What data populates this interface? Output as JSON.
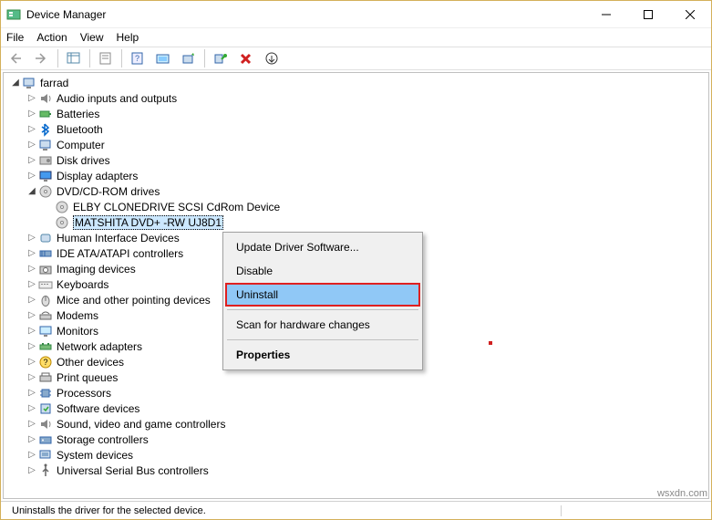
{
  "titlebar": {
    "title": "Device Manager"
  },
  "menubar": {
    "file": "File",
    "action": "Action",
    "view": "View",
    "help": "Help"
  },
  "tree": {
    "root": "farrad",
    "nodes": [
      {
        "label": "Audio inputs and outputs",
        "icon": "speaker"
      },
      {
        "label": "Batteries",
        "icon": "battery"
      },
      {
        "label": "Bluetooth",
        "icon": "bluetooth"
      },
      {
        "label": "Computer",
        "icon": "computer"
      },
      {
        "label": "Disk drives",
        "icon": "disk"
      },
      {
        "label": "Display adapters",
        "icon": "display"
      },
      {
        "label": "DVD/CD-ROM drives",
        "icon": "disc",
        "expanded": true,
        "children": [
          {
            "label": "ELBY CLONEDRIVE SCSI CdRom Device",
            "icon": "disc"
          },
          {
            "label": "MATSHITA DVD+ -RW UJ8D1",
            "icon": "disc",
            "selected": true
          }
        ]
      },
      {
        "label": "Human Interface Devices",
        "icon": "hid"
      },
      {
        "label": "IDE ATA/ATAPI controllers",
        "icon": "ide"
      },
      {
        "label": "Imaging devices",
        "icon": "camera"
      },
      {
        "label": "Keyboards",
        "icon": "keyboard"
      },
      {
        "label": "Mice and other pointing devices",
        "icon": "mouse"
      },
      {
        "label": "Modems",
        "icon": "modem"
      },
      {
        "label": "Monitors",
        "icon": "monitor"
      },
      {
        "label": "Network adapters",
        "icon": "network"
      },
      {
        "label": "Other devices",
        "icon": "unknown"
      },
      {
        "label": "Print queues",
        "icon": "printer"
      },
      {
        "label": "Processors",
        "icon": "cpu"
      },
      {
        "label": "Software devices",
        "icon": "software"
      },
      {
        "label": "Sound, video and game controllers",
        "icon": "sound"
      },
      {
        "label": "Storage controllers",
        "icon": "storage"
      },
      {
        "label": "System devices",
        "icon": "system"
      },
      {
        "label": "Universal Serial Bus controllers",
        "icon": "usb"
      }
    ]
  },
  "context_menu": {
    "update": "Update Driver Software...",
    "disable": "Disable",
    "uninstall": "Uninstall",
    "scan": "Scan for hardware changes",
    "properties": "Properties"
  },
  "statusbar": {
    "text": "Uninstalls the driver for the selected device."
  },
  "watermark": "wsxdn.com"
}
